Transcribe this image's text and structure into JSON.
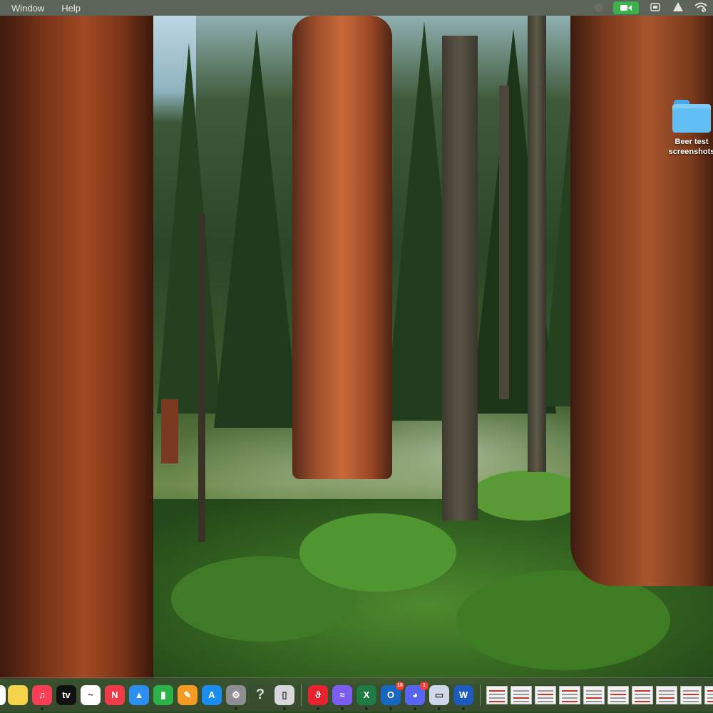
{
  "menubar": {
    "items": [
      "Window",
      "Help"
    ],
    "status_icons": [
      "record-dot-icon",
      "camera-icon",
      "screen-mirror-icon",
      "warning-icon",
      "wifi-icon"
    ]
  },
  "desktop": {
    "items": [
      {
        "label_line1": "Beer test",
        "label_line2": "screenshots",
        "icon": "folder-icon"
      }
    ]
  },
  "dock": {
    "apps": [
      {
        "name": "Notes",
        "icon": "notes-icon",
        "glyph": "",
        "color": "#f6d24b",
        "running": false
      },
      {
        "name": "Music",
        "icon": "music-icon",
        "glyph": "♫",
        "color": "#fa3c55",
        "running": true
      },
      {
        "name": "TV",
        "icon": "appletv-icon",
        "glyph": "tv",
        "color": "#111111",
        "running": false
      },
      {
        "name": "Freeform",
        "icon": "freeform-icon",
        "glyph": "~",
        "color": "#ffffff",
        "running": false
      },
      {
        "name": "News",
        "icon": "news-icon",
        "glyph": "N",
        "color": "#f03a48",
        "running": false
      },
      {
        "name": "Keynote",
        "icon": "keynote-icon",
        "glyph": "▲",
        "color": "#2a8ff0",
        "running": false
      },
      {
        "name": "Numbers",
        "icon": "numbers-icon",
        "glyph": "▮",
        "color": "#2bb34a",
        "running": false
      },
      {
        "name": "Pages",
        "icon": "pages-icon",
        "glyph": "✎",
        "color": "#f59a23",
        "running": false
      },
      {
        "name": "App Store",
        "icon": "appstore-icon",
        "glyph": "A",
        "color": "#1b8cf2",
        "running": false
      },
      {
        "name": "System Settings",
        "icon": "settings-icon",
        "glyph": "⚙",
        "color": "#8e8e93",
        "running": true
      },
      {
        "name": "Unknown",
        "icon": "question-icon",
        "glyph": "?",
        "color": "transparent",
        "running": false
      },
      {
        "name": "iPhone Mirroring",
        "icon": "iphone-icon",
        "glyph": "▯",
        "color": "#d8d8dc",
        "running": true
      }
    ],
    "apps_2": [
      {
        "name": "Scrobbles",
        "icon": "scrobbles-icon",
        "glyph": "ϑ",
        "color": "#e8232f",
        "running": true,
        "badge": ""
      },
      {
        "name": "Messenger",
        "icon": "messenger-icon",
        "glyph": "≈",
        "color": "#7b5cf6",
        "running": true,
        "badge": ""
      },
      {
        "name": "Excel",
        "icon": "excel-icon",
        "glyph": "X",
        "color": "#1f7a43",
        "running": true,
        "badge": ""
      },
      {
        "name": "Outlook",
        "icon": "outlook-icon",
        "glyph": "O",
        "color": "#1666c2",
        "running": true,
        "badge": "16"
      },
      {
        "name": "Discord",
        "icon": "discord-icon",
        "glyph": "◕",
        "color": "#5865f2",
        "running": true,
        "badge": "1"
      },
      {
        "name": "Preview",
        "icon": "preview-icon",
        "glyph": "▭",
        "color": "#cfd8e8",
        "running": true,
        "badge": ""
      },
      {
        "name": "Word",
        "icon": "word-icon",
        "glyph": "W",
        "color": "#1f5bbf",
        "running": true,
        "badge": ""
      }
    ],
    "recent_count_label": "",
    "minimized": [
      {
        "name": "document-thumbnail-1"
      },
      {
        "name": "document-thumbnail-2"
      },
      {
        "name": "document-thumbnail-3"
      },
      {
        "name": "document-thumbnail-4"
      },
      {
        "name": "document-thumbnail-5"
      },
      {
        "name": "document-thumbnail-6"
      },
      {
        "name": "document-thumbnail-7"
      },
      {
        "name": "document-thumbnail-8"
      },
      {
        "name": "document-thumbnail-9"
      },
      {
        "name": "document-thumbnail-10"
      }
    ]
  }
}
